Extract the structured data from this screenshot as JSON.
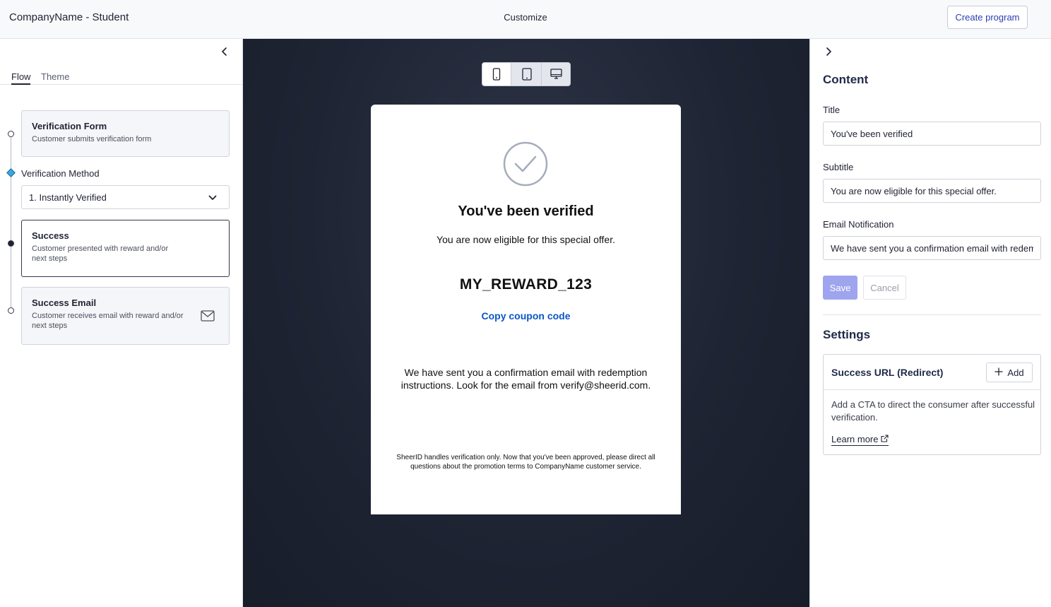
{
  "header": {
    "app_title": "CompanyName - Student",
    "center_title": "Customize",
    "create_label": "Create program"
  },
  "left": {
    "tabs": [
      {
        "label": "Flow",
        "active": true
      },
      {
        "label": "Theme",
        "active": false
      }
    ],
    "steps": [
      {
        "title": "Verification Form",
        "desc": "Customer submits verification form"
      },
      {
        "title": "Success",
        "desc": "Customer presented with reward and/or next steps"
      },
      {
        "title": "Success Email",
        "desc": "Customer receives email with reward and/or next steps"
      }
    ],
    "method": {
      "label": "Verification Method",
      "selected": "1. Instantly Verified"
    }
  },
  "preview": {
    "devices": [
      "phone-icon",
      "tablet-icon",
      "desktop-icon"
    ],
    "active_device": "phone-icon",
    "title": "You've been verified",
    "subtitle": "You are now eligible for this special offer.",
    "code": "MY_REWARD_123",
    "copy_label": "Copy coupon code",
    "email_text": "We have sent you a confirmation email with redemption instructions. Look for the email from verify@sheerid.com.",
    "footer": "SheerID handles verification only. Now that you've been approved, please direct all questions about the promotion terms to CompanyName customer service."
  },
  "right": {
    "content_heading": "Content",
    "fields": {
      "title_label": "Title",
      "title_value": "You've been verified",
      "subtitle_label": "Subtitle",
      "subtitle_value": "You are now eligible for this special offer.",
      "email_label": "Email Notification",
      "email_value": "We have sent you a confirmation email with redemption instructions. Look for the email from verify@sheerid.com."
    },
    "save_label": "Save",
    "cancel_label": "Cancel",
    "settings_heading": "Settings",
    "success_url": {
      "title": "Success URL (Redirect)",
      "add_label": "Add",
      "desc": "Add a CTA to direct the consumer after successful verification.",
      "learn_more": "Learn more"
    }
  },
  "colors": {
    "accent": "#2b3fb0",
    "link": "#0b56c6",
    "save_disabled": "#9ea5ee",
    "timeline_active": "#38a8e0",
    "preview_bg": "#1e2433"
  }
}
